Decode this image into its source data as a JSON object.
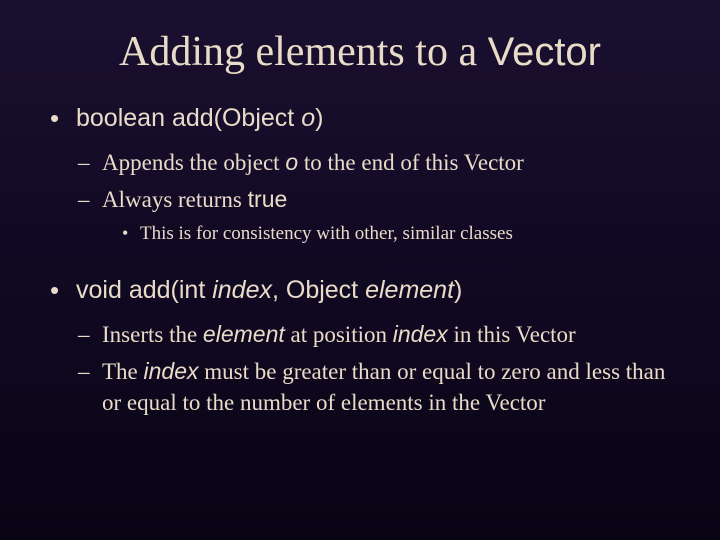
{
  "title": {
    "prefix": "Adding elements to a ",
    "code": "Vector"
  },
  "items": [
    {
      "sig": {
        "ret": "boolean",
        "name": "add(Object ",
        "param": "o",
        "close": ")"
      },
      "sub": [
        {
          "t1": "Appends the object ",
          "c1": "o",
          "t2": " to the end of this Vector"
        },
        {
          "t1": "Always returns ",
          "c1": "true",
          "t2": ""
        }
      ],
      "note": "This is for consistency with other, similar classes"
    },
    {
      "sig": {
        "ret": "void",
        "name": "add(int ",
        "param": "index",
        "mid": ", Object ",
        "param2": "element",
        "close": ")"
      },
      "sub": [
        {
          "t1": "Inserts the ",
          "c1": "element",
          "t2": " at position ",
          "c2": "index",
          "t3": " in this Vector"
        },
        {
          "t1": "The ",
          "c1": "index",
          "t2": " must be greater than or equal to zero and less than or equal to the number of elements in the Vector"
        }
      ]
    }
  ]
}
